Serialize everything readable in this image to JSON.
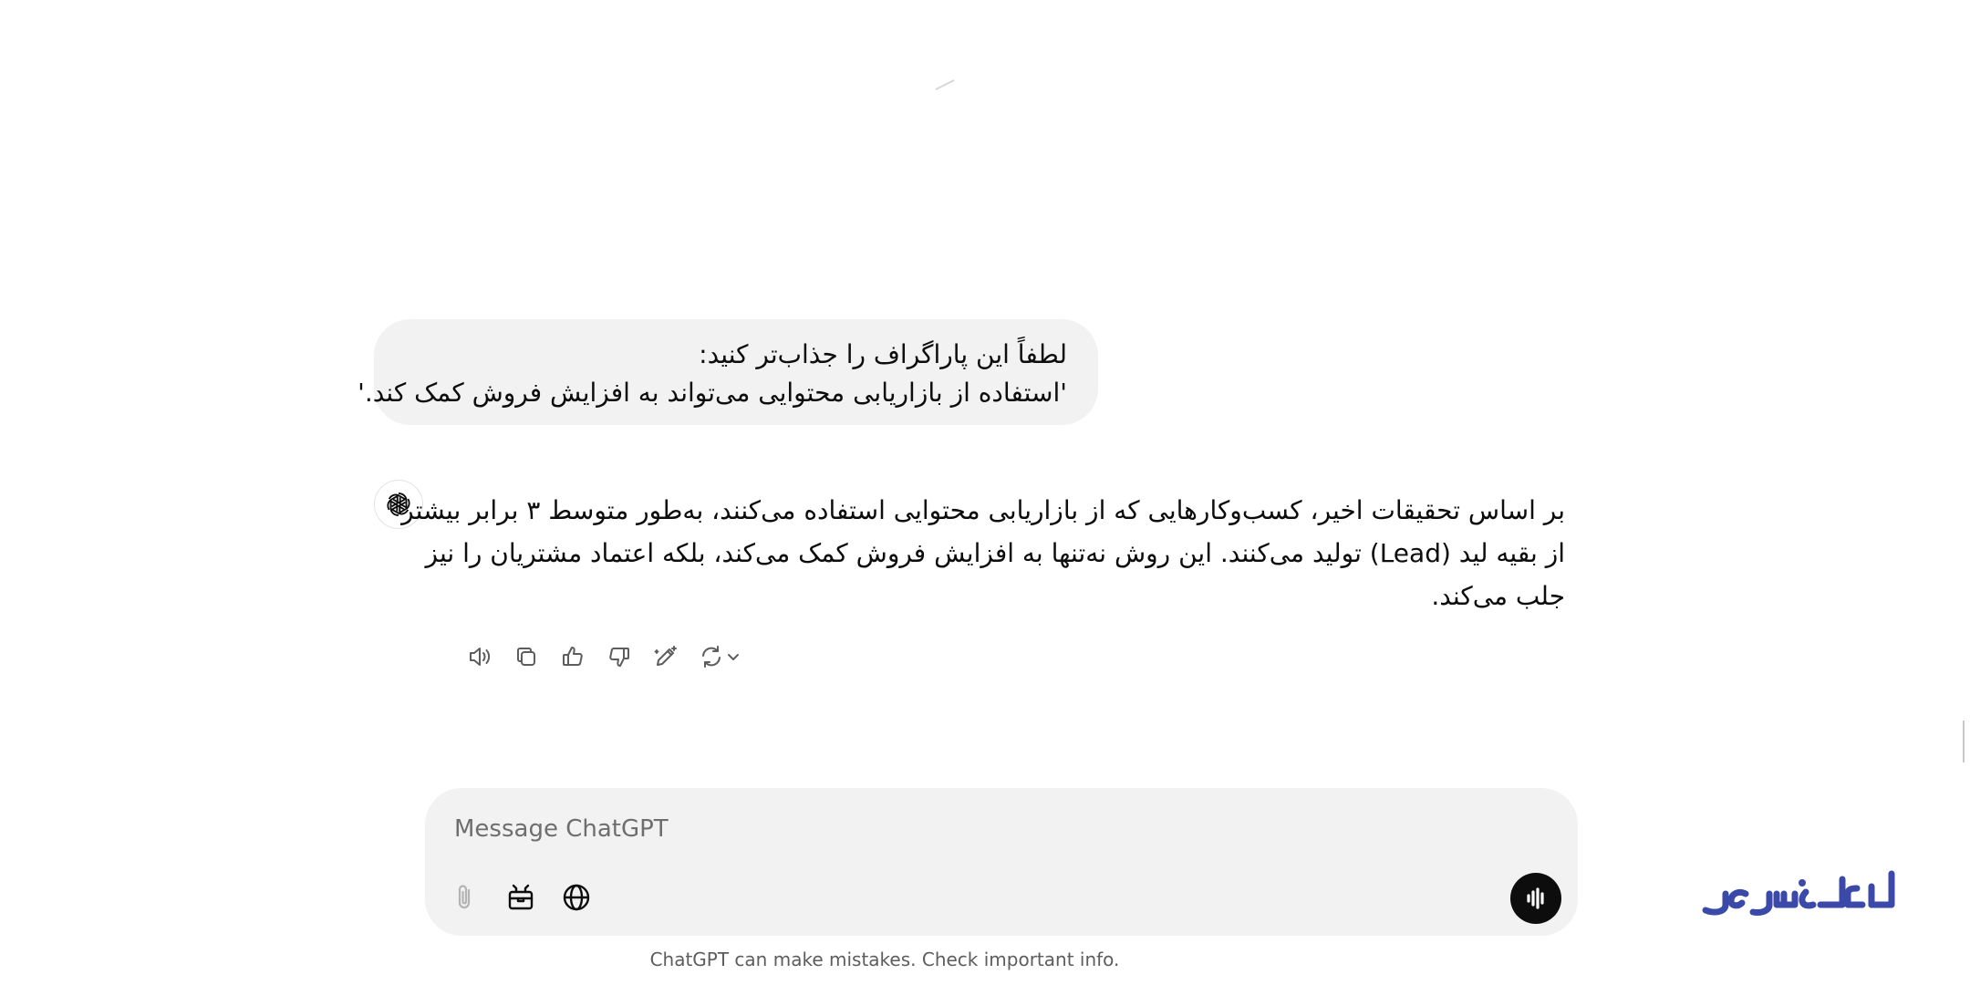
{
  "conversation": {
    "user_message": {
      "lines": [
        "لطفاً این پاراگراف را جذاب‌تر کنید:",
        "'استفاده از بازاریابی محتوایی می‌تواند به افزایش فروش کمک کند.'"
      ]
    },
    "assistant_message": {
      "lines": [
        "بر اساس تحقیقات اخیر، کسب‌وکارهایی که از بازاریابی محتوایی استفاده می‌کنند، به‌طور متوسط ۳ برابر بیشتر",
        "از بقیه لید (Lead) تولید می‌کنند. این روش نه‌تنها به افزایش فروش کمک می‌کند، بلکه اعتماد مشتریان را نیز",
        "جلب می‌کند."
      ],
      "actions": [
        {
          "name": "read-aloud",
          "icon": "speaker-icon"
        },
        {
          "name": "copy",
          "icon": "copy-icon"
        },
        {
          "name": "good-response",
          "icon": "thumbs-up-icon"
        },
        {
          "name": "bad-response",
          "icon": "thumbs-down-icon"
        },
        {
          "name": "edit-in-canvas",
          "icon": "pencil-sparkle-icon"
        },
        {
          "name": "regenerate",
          "icon": "refresh-icon"
        }
      ]
    }
  },
  "composer": {
    "placeholder": "Message ChatGPT",
    "tools": [
      "paperclip-icon",
      "toolbox-icon",
      "globe-icon"
    ],
    "voice_icon": "voice-waveform-icon"
  },
  "footer": {
    "disclaimer": "ChatGPT can make mistakes. Check important info."
  },
  "watermark": {
    "brand": "ایران سرور",
    "color": "#3b4aa8"
  }
}
